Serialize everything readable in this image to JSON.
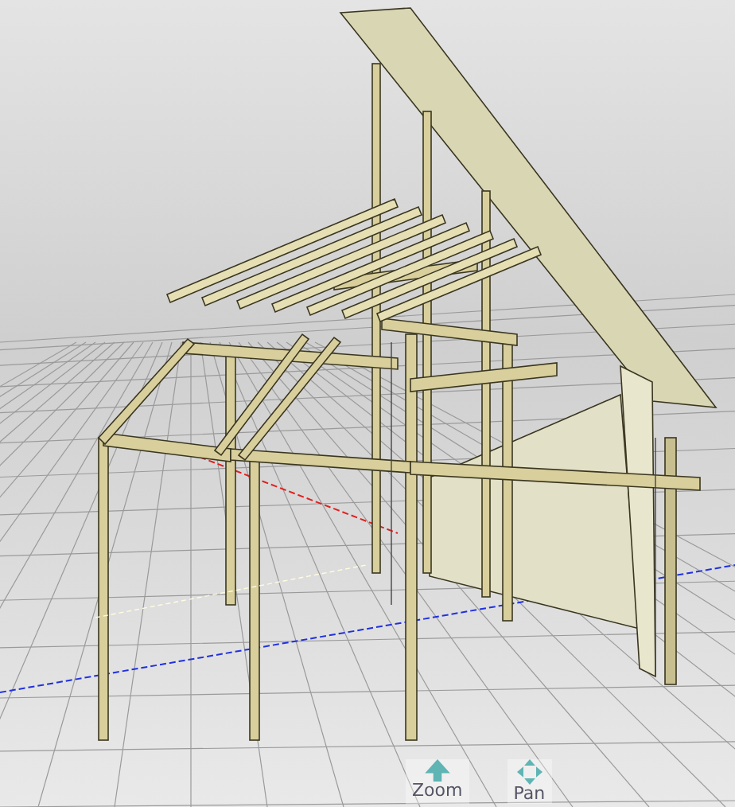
{
  "viewport": {
    "nav_controls": [
      {
        "label": "Zoom",
        "kind": "zoom"
      },
      {
        "label": "Pan",
        "kind": "pan"
      }
    ]
  }
}
